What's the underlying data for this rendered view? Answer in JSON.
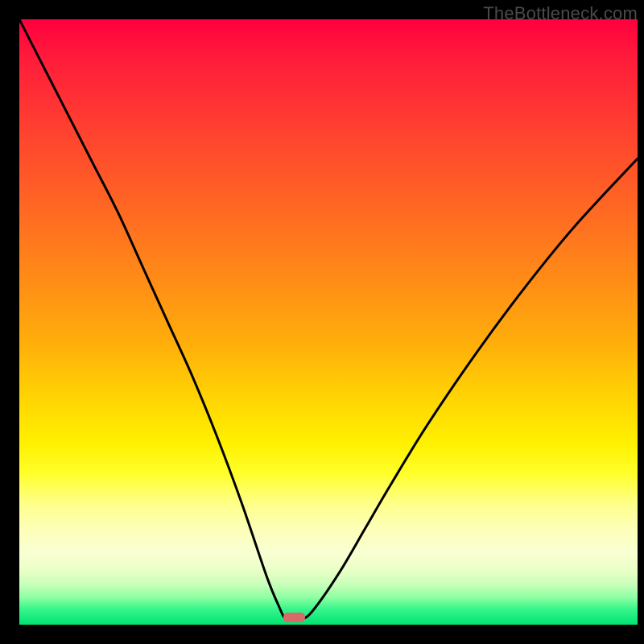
{
  "watermark": "TheBottleneck.com",
  "chart_data": {
    "type": "line",
    "title": "",
    "xlabel": "",
    "ylabel": "",
    "xlim": [
      0,
      100
    ],
    "ylim": [
      0,
      100
    ],
    "grid": false,
    "background_gradient": {
      "direction": "vertical",
      "stops": [
        {
          "pos": 0.0,
          "color": "#ff003e"
        },
        {
          "pos": 0.18,
          "color": "#ff4030"
        },
        {
          "pos": 0.44,
          "color": "#ff8f15"
        },
        {
          "pos": 0.62,
          "color": "#ffd203"
        },
        {
          "pos": 0.7,
          "color": "#fff000"
        },
        {
          "pos": 0.88,
          "color": "#faffd2"
        },
        {
          "pos": 0.96,
          "color": "#8dffa2"
        },
        {
          "pos": 1.0,
          "color": "#00e372"
        }
      ]
    },
    "series": [
      {
        "name": "bottleneck-curve",
        "color": "#000000",
        "x": [
          0,
          4,
          8,
          12,
          16,
          20,
          24,
          28,
          32,
          36,
          40,
          42,
          43,
          44,
          46,
          48,
          52,
          56,
          60,
          66,
          74,
          82,
          90,
          100
        ],
        "y": [
          100,
          92,
          84,
          76,
          68,
          59,
          50,
          41,
          31,
          20,
          8,
          3,
          1,
          1,
          1,
          3,
          9,
          16,
          23,
          33,
          45,
          56,
          66,
          77
        ]
      }
    ],
    "marker": {
      "name": "optimal-marker",
      "color": "#d96a6a",
      "x": 44.5,
      "y": 1.2,
      "w": 3.5,
      "h": 1.6
    }
  }
}
